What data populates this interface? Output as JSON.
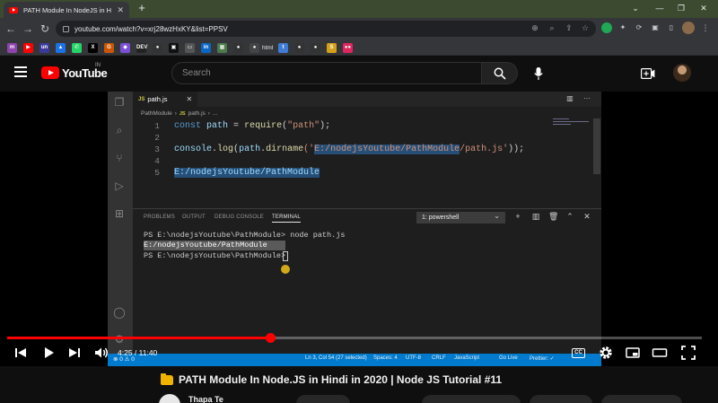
{
  "browser": {
    "tab_title": "PATH Module In NodeJS in H",
    "url": "youtube.com/watch?v=xrj28wzHxKY&list=PPSV",
    "bookmarks": [
      {
        "label": "",
        "color": "#8e44ad",
        "text": "m"
      },
      {
        "label": "",
        "color": "#ff0000",
        "text": "▶"
      },
      {
        "label": "",
        "color": "#3a3a9a",
        "text": "un"
      },
      {
        "label": "",
        "color": "#1a73e8",
        "text": "▲"
      },
      {
        "label": "",
        "color": "#25d366",
        "text": "✆"
      },
      {
        "label": "",
        "color": "#000000",
        "text": "X"
      },
      {
        "label": "",
        "color": "#cc5500",
        "text": "G"
      },
      {
        "label": "",
        "color": "#7b4fd6",
        "text": "◆"
      },
      {
        "label": "",
        "color": "#222222",
        "text": "DEV"
      },
      {
        "label": "",
        "color": "#333333",
        "text": "●"
      },
      {
        "label": "",
        "color": "#111111",
        "text": "▣"
      },
      {
        "label": "",
        "color": "#555555",
        "text": "▭"
      },
      {
        "label": "",
        "color": "#0a66c2",
        "text": "in"
      },
      {
        "label": "",
        "color": "#4a7a4a",
        "text": "▦"
      },
      {
        "label": "",
        "color": "#333333",
        "text": "●"
      },
      {
        "label": "html",
        "color": "#444444",
        "text": "●"
      },
      {
        "label": "",
        "color": "#3d7bd6",
        "text": "t"
      },
      {
        "label": "",
        "color": "#333333",
        "text": "●"
      },
      {
        "label": "",
        "color": "#333333",
        "text": "●"
      },
      {
        "label": "",
        "color": "#d4a017",
        "text": "S"
      },
      {
        "label": "",
        "color": "#e0245e",
        "text": "●●"
      }
    ]
  },
  "youtube": {
    "logo_text": "YouTube",
    "region": "IN",
    "search_placeholder": "Search",
    "video_title": "PATH Module In Node.JS in Hindi in 2020 | Node JS Tutorial #11",
    "channel_name": "Thapa Te",
    "player": {
      "current_time": "4:25",
      "duration": "11:40",
      "time_display": "4:25 / 11:40",
      "progress_fraction": 0.3786,
      "cc_label": "CC"
    }
  },
  "vscode": {
    "file_tab": "path.js",
    "file_badge": "JS",
    "breadcrumb_folder": "PathModule",
    "breadcrumb_file": "path.js",
    "breadcrumb_more": "...",
    "line_numbers": [
      "1",
      "2",
      "3",
      "4",
      "5"
    ],
    "code": {
      "l1_kw": "const",
      "l1_var": "path",
      "l1_eq": " = ",
      "l1_fn": "require",
      "l1_open": "(",
      "l1_str": "\"path\"",
      "l1_close": ");",
      "l3_obj": "console",
      "l3_dot": ".",
      "l3_fn": "log",
      "l3_open": "(",
      "l3_var": "path",
      "l3_dot2": ".",
      "l3_fn2": "dirname",
      "l3_open2": "('",
      "l3_sel": "E:/nodejsYoutube/PathModule",
      "l3_rest": "/path.js'",
      "l3_close": "));",
      "l5": "E:/nodejsYoutube/PathModule"
    },
    "panel_tabs": [
      "PROBLEMS",
      "OUTPUT",
      "DEBUG CONSOLE",
      "TERMINAL"
    ],
    "terminal_select": "1: powershell",
    "terminal_lines": [
      "PS E:\\nodejsYoutube\\PathModule> node path.js",
      "E:/nodejsYoutube/PathModule",
      "PS E:\\nodejsYoutube\\PathModule> "
    ],
    "status_left": "⊗ 0 ⚠ 0",
    "status_items": [
      "Ln 3, Col 54 (27 selected)",
      "Spaces: 4",
      "UTF-8",
      "CRLF",
      "JavaScript",
      "Go Live",
      "Prettier: ✓"
    ]
  }
}
